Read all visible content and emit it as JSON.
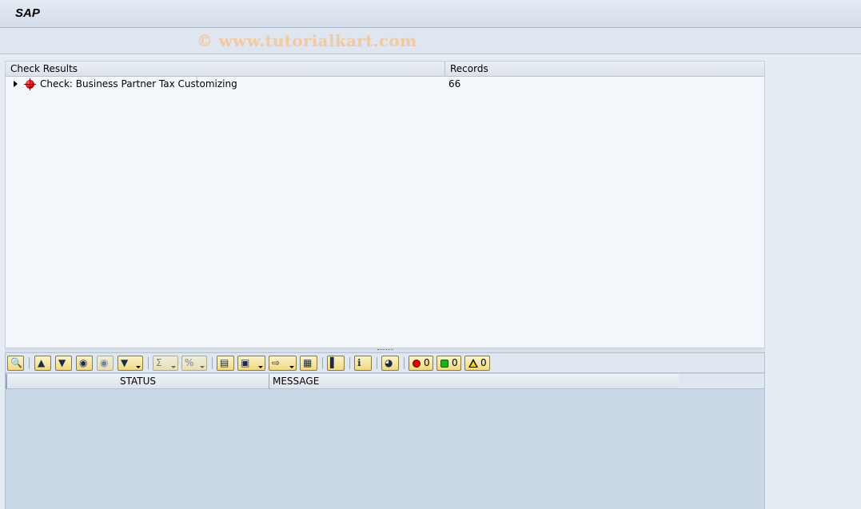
{
  "header": {
    "app_title": "SAP",
    "watermark": "© www.tutorialkart.com"
  },
  "tree": {
    "columns": [
      "Check Results",
      "Records"
    ],
    "rows": [
      {
        "label": "Check: Business Partner Tax Customizing",
        "records": "66",
        "status": "error"
      }
    ]
  },
  "toolbar": {
    "buttons": [
      {
        "name": "details",
        "icon": "magnifier-icon"
      },
      {
        "name": "sort-ascending",
        "icon": "sort-ascending-icon"
      },
      {
        "name": "sort-descending",
        "icon": "sort-descending-icon"
      },
      {
        "name": "find",
        "icon": "binoculars-icon"
      },
      {
        "name": "find-next",
        "icon": "binoculars-next-icon"
      },
      {
        "name": "filter",
        "icon": "filter-icon",
        "dropdown": true
      },
      {
        "name": "total",
        "icon": "sum-icon",
        "dropdown": true,
        "disabled": true
      },
      {
        "name": "subtotal",
        "icon": "subtotal-icon",
        "dropdown": true,
        "disabled": true
      },
      {
        "name": "print-preview",
        "icon": "print-preview-icon"
      },
      {
        "name": "views",
        "icon": "views-icon",
        "dropdown": true
      },
      {
        "name": "export",
        "icon": "export-icon",
        "dropdown": true
      },
      {
        "name": "change-layout",
        "icon": "layout-grid-icon"
      },
      {
        "name": "graphic",
        "icon": "bar-chart-icon"
      },
      {
        "name": "information",
        "icon": "info-icon"
      },
      {
        "name": "abc-analysis",
        "icon": "pie-chart-icon"
      }
    ],
    "counters": {
      "errors": "0",
      "success": "0",
      "warnings": "0"
    }
  },
  "grid": {
    "columns": [
      "STATUS",
      "MESSAGE"
    ]
  }
}
